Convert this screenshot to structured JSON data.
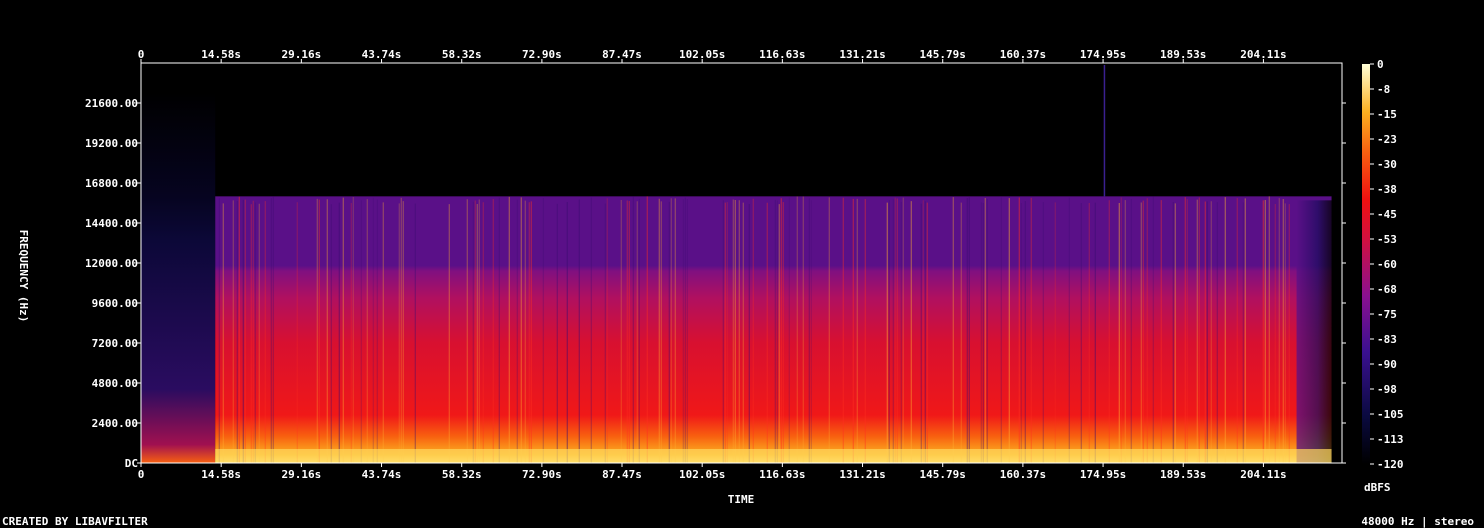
{
  "chart_data": {
    "type": "heatmap",
    "x_ticks": [
      "0",
      "14.58s",
      "29.16s",
      "43.74s",
      "58.32s",
      "72.90s",
      "87.47s",
      "102.05s",
      "116.63s",
      "131.21s",
      "145.79s",
      "160.37s",
      "174.95s",
      "189.53s",
      "204.11s"
    ],
    "x_tick_values": [
      0,
      14.58,
      29.16,
      43.74,
      58.32,
      72.9,
      87.47,
      102.05,
      116.63,
      131.21,
      145.79,
      160.37,
      174.95,
      189.53,
      204.11
    ],
    "xlim": [
      0,
      218.4
    ],
    "y_ticks": [
      "DC",
      "2400.00",
      "4800.00",
      "7200.00",
      "9600.00",
      "12000.00",
      "14400.00",
      "16800.00",
      "19200.00",
      "21600.00"
    ],
    "y_tick_values": [
      0,
      2400,
      4800,
      7200,
      9600,
      12000,
      14400,
      16800,
      19200,
      21600
    ],
    "ylim": [
      0,
      24000
    ],
    "xlabel": "TIME",
    "ylabel": "FREQUENCY (Hz)",
    "colorbar": {
      "label": "dBFS",
      "ticks": [
        "0",
        "-8",
        "-15",
        "-23",
        "-30",
        "-38",
        "-45",
        "-53",
        "-60",
        "-68",
        "-75",
        "-83",
        "-90",
        "-98",
        "-105",
        "-113",
        "-120"
      ],
      "range": [
        -120,
        0
      ]
    },
    "content": {
      "content_start_s": 13.5,
      "content_end_s": 216.5,
      "lowpass_cutoff_hz": 16000,
      "spike_time_s": 175.2
    }
  },
  "footer": {
    "left": "CREATED BY LIBAVFILTER",
    "right": "48000 Hz | stereo"
  }
}
